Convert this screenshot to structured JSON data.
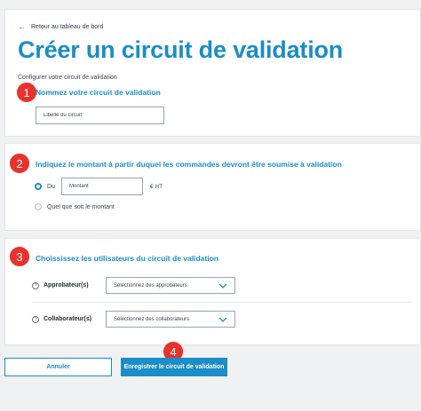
{
  "header": {
    "back_label": "Retour au tableau de bord",
    "title": "Créer un circuit de validation",
    "subtitle": "Configurer votre circuit de validation"
  },
  "steps": [
    "1",
    "2",
    "3",
    "4"
  ],
  "section_name": {
    "title": "Nommez votre circuit de validation",
    "input_placeholder": "Libellé du circuit"
  },
  "section_amount": {
    "title": "Indiquez le montant à partir duquel les commandes devront être soumise à validation",
    "option_from_label": "Du",
    "amount_placeholder": "Montant",
    "unit": "€ HT",
    "option_any_label": "Quel que soit le montant"
  },
  "section_users": {
    "title": "Choississez les utilisateurs du circuit de validation",
    "approvers_label": "Approbateur(s)",
    "approvers_placeholder": "Sélectionnez des approbateurs",
    "collaborators_label": "Collaborateur(s)",
    "collaborators_placeholder": "Sélectionnez des collaborateurs",
    "help_glyph": "?"
  },
  "actions": {
    "cancel_label": "Annuler",
    "save_label": "Enregistrer le circuit de validation"
  },
  "colors": {
    "accent": "#1b8dc8",
    "badge": "#e8322c"
  }
}
